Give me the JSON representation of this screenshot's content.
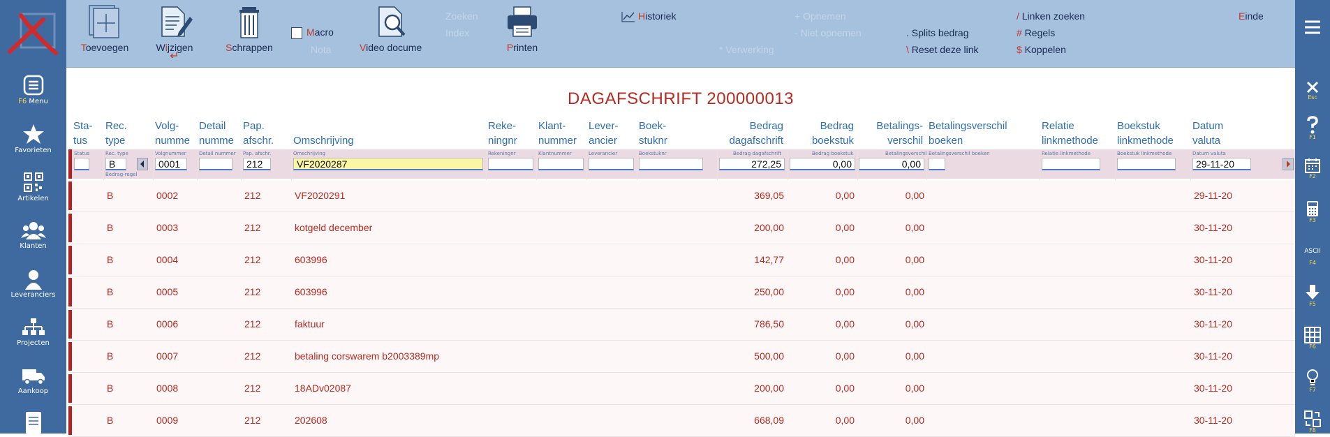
{
  "sidebar": {
    "items": [
      {
        "hotkey": "F6",
        "label": "Menu",
        "icon": "menu-icon"
      },
      {
        "label": "Favorieten",
        "icon": "star-icon"
      },
      {
        "label": "Artikelen",
        "icon": "qr-icon"
      },
      {
        "label": "Klanten",
        "icon": "people-icon"
      },
      {
        "label": "Leveranciers",
        "icon": "person-icon"
      },
      {
        "label": "Projecten",
        "icon": "org-chart-icon"
      },
      {
        "label": "Aankoop",
        "icon": "truck-icon"
      }
    ]
  },
  "toolbar": {
    "add": {
      "hk": "T",
      "rest": "oevoegen"
    },
    "edit": {
      "pre": "W",
      "hk": "i",
      "rest": "jzigen"
    },
    "delete": {
      "hk": "S",
      "rest": "chrappen"
    },
    "macro": {
      "hk": "M",
      "rest": "acro"
    },
    "nota": "Nota",
    "video": {
      "hk": "V",
      "rest": "ideo docume"
    },
    "search": "Zoeken",
    "index": "Index",
    "print": {
      "hk": "P",
      "rest": "rinten"
    },
    "history": {
      "hk": "H",
      "rest": "istoriek"
    },
    "opnemen": "+ Opnemen",
    "niet_opnemen": "- Niet opnemen",
    "verwerking": "* Verwerking",
    "splits": {
      "hk": ".",
      "rest": " Splits bedrag"
    },
    "reset": {
      "hk": "\\",
      "rest": " Reset deze link"
    },
    "linken": {
      "hk": "/",
      "rest": " Linken zoeken"
    },
    "regels": {
      "hk": "#",
      "rest": " Regels"
    },
    "koppelen": {
      "hk": "$",
      "rest": " Koppelen"
    },
    "einde": {
      "hk": "E",
      "rest": "inde"
    }
  },
  "title": "DAGAFSCHRIFT 200000013",
  "columns": {
    "status": [
      "Sta-",
      "tus"
    ],
    "rectype": [
      "Rec.",
      "type"
    ],
    "volgnummer": [
      "Volg-",
      "numme"
    ],
    "detail": [
      "Detail",
      "numme"
    ],
    "pap": [
      "Pap.",
      "afschr."
    ],
    "omschrijving": [
      "",
      "Omschrijving"
    ],
    "rekeningnr": [
      "Reke-",
      "ningnr"
    ],
    "klantnummer": [
      "Klant-",
      "nummer"
    ],
    "leverancier": [
      "Lever-",
      "ancier"
    ],
    "boekstuknr": [
      "Boek-",
      "stuknr"
    ],
    "bedrag_dag": [
      "Bedrag",
      "dagafschrift"
    ],
    "bedrag_boek": [
      "Bedrag",
      "boekstuk"
    ],
    "bet_verschil": [
      "Betalings-",
      "verschil"
    ],
    "bet_boeken": [
      "Betalingsverschil",
      "boeken"
    ],
    "relatie": [
      "Relatie",
      "linkmethode"
    ],
    "boekstuk_link": [
      "Boekstuk",
      "linkmethode"
    ],
    "datum": [
      "Datum",
      "valuta"
    ]
  },
  "edit_row": {
    "mini_labels": {
      "status": "Status",
      "rectype": "Rec. type",
      "rectype_sub": "Bedrag-regel",
      "volg": "Volgnummer",
      "detail": "Detail nummer",
      "pap": "Pap. afschr.",
      "omschr": "Omschrijving",
      "rek": "Rekeningnr",
      "klant": "Klantnummer",
      "lev": "Leverancier",
      "boek": "Boekstuknr",
      "bdag": "Bedrag dagafschrift",
      "bboek": "Bedrag boekstuk",
      "bver": "Betalingsverschil",
      "bvboek": "Betalingsverschil boeken",
      "rel": "Relatie linkmethode",
      "bslink": "Boekstuk linkmethode",
      "datum": "Datum valuta"
    },
    "rectype": "B",
    "volgnummer": "0001",
    "pap": "212",
    "omschrijving": "VF2020287",
    "bedrag_dag": "272,25",
    "bedrag_boek": "0,00",
    "bet_verschil": "0,00",
    "datum": "29-11-20"
  },
  "rows": [
    {
      "type": "B",
      "nr": "0002",
      "pap": "212",
      "omschr": "VF2020291",
      "bdag": "369,05",
      "bboek": "0,00",
      "bver": "0,00",
      "datum": "29-11-20"
    },
    {
      "type": "B",
      "nr": "0003",
      "pap": "212",
      "omschr": "kotgeld december",
      "bdag": "200,00",
      "bboek": "0,00",
      "bver": "0,00",
      "datum": "30-11-20"
    },
    {
      "type": "B",
      "nr": "0004",
      "pap": "212",
      "omschr": "603996",
      "bdag": "142,77",
      "bboek": "0,00",
      "bver": "0,00",
      "datum": "30-11-20"
    },
    {
      "type": "B",
      "nr": "0005",
      "pap": "212",
      "omschr": "603996",
      "bdag": "250,00",
      "bboek": "0,00",
      "bver": "0,00",
      "datum": "30-11-20"
    },
    {
      "type": "B",
      "nr": "0006",
      "pap": "212",
      "omschr": "faktuur",
      "bdag": "786,50",
      "bboek": "0,00",
      "bver": "0,00",
      "datum": "30-11-20"
    },
    {
      "type": "B",
      "nr": "0007",
      "pap": "212",
      "omschr": "betaling corswarem b2003389mp",
      "bdag": "500,00",
      "bboek": "0,00",
      "bver": "0,00",
      "datum": "30-11-20"
    },
    {
      "type": "B",
      "nr": "0008",
      "pap": "212",
      "omschr": "18ADv02087",
      "bdag": "200,00",
      "bboek": "0,00",
      "bver": "0,00",
      "datum": "30-11-20"
    },
    {
      "type": "B",
      "nr": "0009",
      "pap": "212",
      "omschr": "202608",
      "bdag": "668,09",
      "bboek": "0,00",
      "bver": "0,00",
      "datum": "30-11-20"
    }
  ],
  "rightbar": [
    {
      "label": "Esc",
      "icon": "close-icon"
    },
    {
      "label": "F1",
      "icon": "help-icon"
    },
    {
      "label": "F2",
      "icon": "calendar-icon"
    },
    {
      "label": "F3",
      "icon": "calculator-icon"
    },
    {
      "label": "F4",
      "icon": "ascii-icon",
      "text": "ASCII"
    },
    {
      "label": "F5",
      "icon": "download-icon"
    },
    {
      "label": "F6",
      "icon": "grid-icon"
    },
    {
      "label": "F7",
      "icon": "lightbulb-icon"
    },
    {
      "label": "F8",
      "icon": "swap-icon"
    }
  ],
  "colors": {
    "sidebar": "#3e6a9f",
    "toolbar": "#a6c1de",
    "accent_red": "#b8291f",
    "header_blue": "#2d6fb4"
  }
}
